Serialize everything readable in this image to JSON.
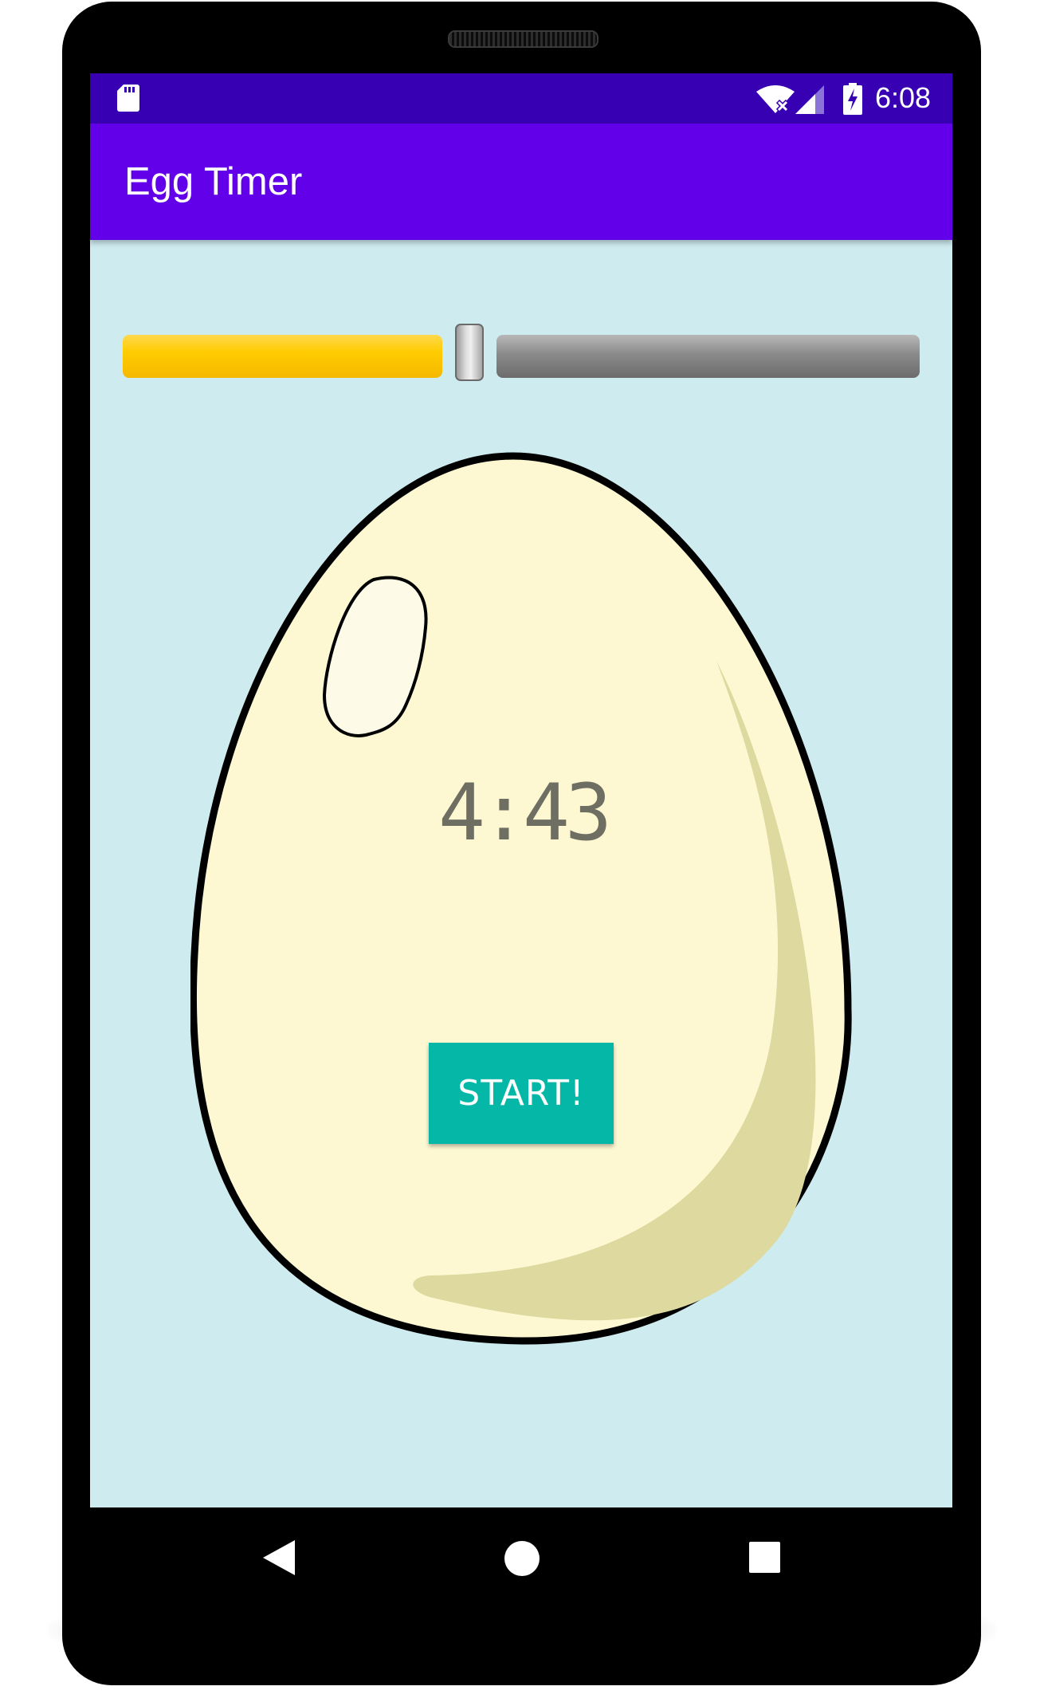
{
  "status_bar": {
    "time": "6:08",
    "icons": [
      "sd-card-icon",
      "wifi-off-icon",
      "signal-icon",
      "battery-charging-icon"
    ]
  },
  "app_bar": {
    "title": "Egg Timer"
  },
  "slider": {
    "value_fraction": 0.43
  },
  "egg": {
    "timer": "4:43",
    "start_label": "START!"
  },
  "navigation": {
    "icons": [
      "back-icon",
      "home-icon",
      "recents-icon"
    ]
  },
  "colors": {
    "status_bar": "#3700b3",
    "app_bar": "#6200ea",
    "background": "#ceebef",
    "slider_active": "#ffcc00",
    "slider_inactive": "#7a7a7a",
    "egg_fill": "#fdf8d2",
    "egg_shade": "#ddd99f",
    "start_button": "#05b7a6",
    "timer_text": "#6e6e62"
  }
}
